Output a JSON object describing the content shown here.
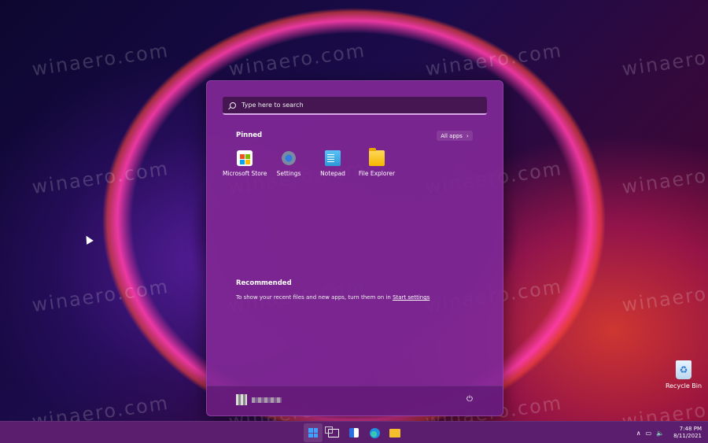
{
  "desktop": {
    "watermark": "winaero.com",
    "icons": [
      {
        "label": "Recycle Bin",
        "icon": "recycle-bin-icon"
      }
    ]
  },
  "start_menu": {
    "search": {
      "placeholder": "Type here to search"
    },
    "pinned": {
      "title": "Pinned",
      "all_apps_label": "All apps",
      "apps": [
        {
          "label": "Microsoft Store",
          "icon": "microsoft-store-icon"
        },
        {
          "label": "Settings",
          "icon": "settings-gear-icon"
        },
        {
          "label": "Notepad",
          "icon": "notepad-icon"
        },
        {
          "label": "File Explorer",
          "icon": "folder-icon"
        }
      ]
    },
    "recommended": {
      "title": "Recommended",
      "message": "To show your recent files and new apps, turn them on in",
      "link": "Start settings"
    },
    "footer": {
      "power_icon": "power-icon"
    }
  },
  "taskbar": {
    "apps": [
      "start",
      "task-view",
      "widgets",
      "edge",
      "file-explorer"
    ],
    "tray": {
      "time": "7:48 PM",
      "date": "8/11/2021"
    }
  },
  "colors": {
    "start_bg": "#80289a",
    "taskbar_bg": "#5b1e6e",
    "accent": "#3fa2ff"
  }
}
